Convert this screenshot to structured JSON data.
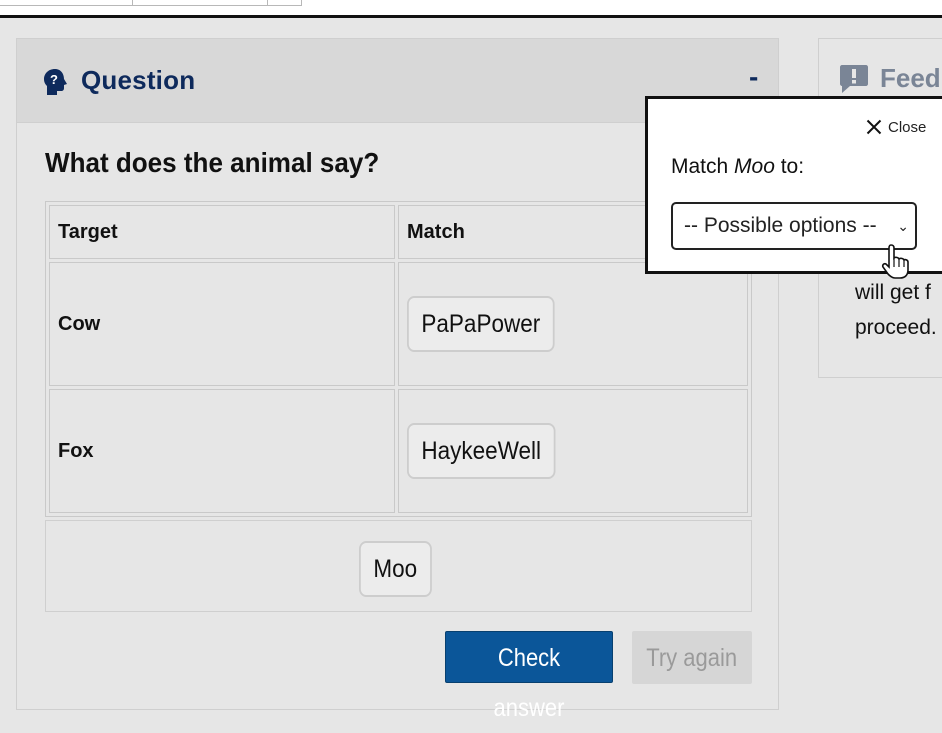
{
  "question_panel": {
    "title": "Question",
    "collapse_label": "-",
    "prompt": "What does the animal say?",
    "table": {
      "headers": [
        "Target",
        "Match"
      ],
      "rows": [
        {
          "target": "Cow",
          "match": "PaPaPower"
        },
        {
          "target": "Fox",
          "match": "HaykeeWell"
        }
      ]
    },
    "pool_items": [
      "Moo"
    ],
    "buttons": {
      "check": "Check answer",
      "try_again": "Try again"
    }
  },
  "feedback_panel": {
    "title": "Feedb",
    "body_lines": [
      "will get f",
      "proceed."
    ]
  },
  "popup": {
    "close_label": "Close",
    "label_prefix": "Match ",
    "label_term": "Moo",
    "label_suffix": " to:",
    "select_value": "-- Possible options --"
  },
  "colors": {
    "accent": "#0b5699",
    "header_text": "#0e2a5c",
    "feedback_header": "#7a8596",
    "panel_bg": "#e6e6e6"
  },
  "icons": {
    "question_icon": "head-question-icon",
    "feedback_icon": "comment-exclamation-icon",
    "close_icon": "close-icon",
    "select_icon": "chevron-down-icon",
    "cursor": "hand-pointer-cursor"
  }
}
